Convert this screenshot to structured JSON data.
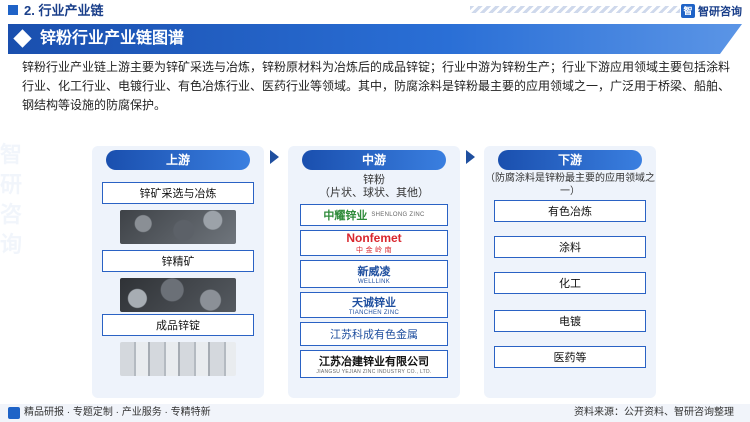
{
  "header": {
    "section_title": "2. 行业产业链",
    "logo_mark": "智",
    "logo_text": "智研咨询"
  },
  "banner": {
    "title": "锌粉行业产业链图谱"
  },
  "intro": "锌粉行业产业链上游主要为锌矿采选与冶炼，锌粉原材料为冶炼后的成品锌锭；行业中游为锌粉生产；行业下游应用领域主要包括涂料行业、化工行业、电镀行业、有色冶炼行业、医药行业等领域。其中，防腐涂料是锌粉最主要的应用领域之一，广泛用于桥梁、船舶、钢结构等设施的防腐保护。",
  "upstream": {
    "title": "上游",
    "items": [
      "锌矿采选与冶炼",
      "锌精矿",
      "成品锌锭"
    ]
  },
  "midstream": {
    "title": "中游",
    "product": "锌粉",
    "product_forms": "（片状、球状、其他）",
    "companies": [
      {
        "name": "中耀锌业",
        "sub": "SHENLONG ZINC",
        "color": "#2e8b3a"
      },
      {
        "name": "Nonfemet",
        "sub": "中 金 岭 南",
        "color": "#d9272e"
      },
      {
        "name": "新威凌",
        "sub": "WELLLINK",
        "color": "#1f4f9f"
      },
      {
        "name": "天诚锌业",
        "sub": "TIANCHEN ZINC",
        "color": "#1f4f9f"
      },
      {
        "name": "江苏科成有色金属",
        "sub": "",
        "color": "#1f4f9f"
      },
      {
        "name": "江苏冶建锌业有限公司",
        "sub": "JIANGSU YEJIAN ZINC INDUSTRY CO., LTD.",
        "color": "#111111"
      }
    ]
  },
  "downstream": {
    "title": "下游",
    "note": "（防腐涂料是锌粉最主要的应用领域之一）",
    "items": [
      "有色冶炼",
      "涂料",
      "化工",
      "电镀",
      "医药等"
    ]
  },
  "footer": {
    "left": "精品研报 · 专题定制 · 产业服务 · 专精特新",
    "right": "资料来源：公开资料、智研咨询整理"
  },
  "colors": {
    "accent": "#1f63c7",
    "border": "#2a62c4"
  }
}
